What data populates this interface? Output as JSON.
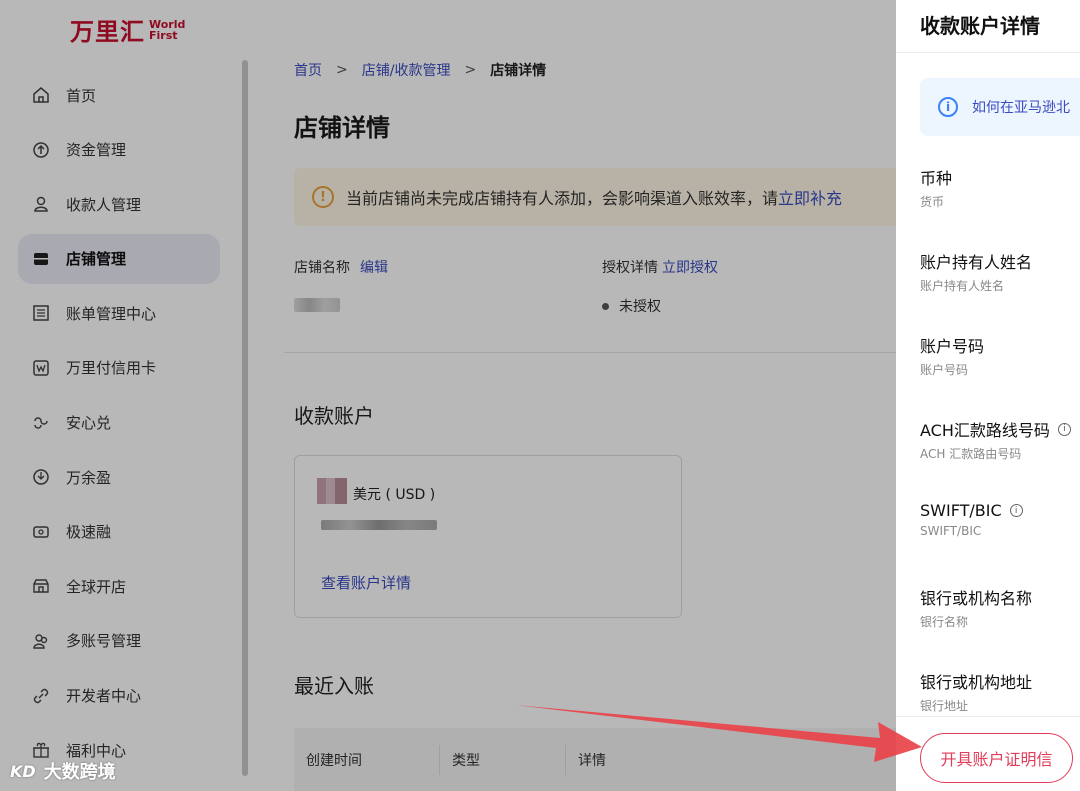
{
  "logo": {
    "cn": "万里汇",
    "en_line1": "World",
    "en_line2": "First"
  },
  "sidebar": {
    "items": [
      {
        "label": "首页",
        "icon": "home-icon"
      },
      {
        "label": "资金管理",
        "icon": "upload-circle-icon"
      },
      {
        "label": "收款人管理",
        "icon": "user-icon"
      },
      {
        "label": "店铺管理",
        "icon": "store-icon",
        "active": true
      },
      {
        "label": "账单管理中心",
        "icon": "list-icon"
      },
      {
        "label": "万里付信用卡",
        "icon": "card-w-icon"
      },
      {
        "label": "安心兑",
        "icon": "exchange-icon"
      },
      {
        "label": "万余盈",
        "icon": "shield-icon"
      },
      {
        "label": "极速融",
        "icon": "money-icon"
      },
      {
        "label": "全球开店",
        "icon": "shop-icon"
      },
      {
        "label": "多账号管理",
        "icon": "users-icon"
      },
      {
        "label": "开发者中心",
        "icon": "link-icon"
      },
      {
        "label": "福利中心",
        "icon": "gift-icon"
      }
    ]
  },
  "breadcrumb": {
    "home": "首页",
    "sep": ">",
    "parent": "店铺/收款管理",
    "current": "店铺详情"
  },
  "page": {
    "title": "店铺详情",
    "warning_text": "当前店铺尚未完成店铺持有人添加，会影响渠道入账效率，请",
    "warning_link": "立即补充",
    "store_name_label": "店铺名称",
    "store_name_edit": "编辑",
    "auth_label": "授权详情",
    "auth_link": "立即授权",
    "auth_status": "未授权",
    "accounts_title": "收款账户",
    "account_currency": "美元 ( USD )",
    "account_link": "查看账户详情",
    "recent_title": "最近入账",
    "table_headers": [
      "创建时间",
      "类型",
      "详情"
    ]
  },
  "drawer": {
    "title": "收款账户详情",
    "info_text": "如何在亚马逊北",
    "fields": [
      {
        "label": "币种",
        "sub": "货币"
      },
      {
        "label": "账户持有人姓名",
        "sub": "账户持有人姓名"
      },
      {
        "label": "账户号码",
        "sub": "账户号码"
      },
      {
        "label": "ACH汇款路线号码",
        "sub": "ACH 汇款路由号码"
      },
      {
        "label": "SWIFT/BIC",
        "sub": "SWIFT/BIC"
      },
      {
        "label": "银行或机构名称",
        "sub": "银行名称"
      },
      {
        "label": "银行或机构地址",
        "sub": "银行地址"
      }
    ],
    "cert_button": "开具账户证明信"
  },
  "watermark": {
    "logo": "KD",
    "text": "大数跨境"
  },
  "colors": {
    "brand": "#c8102e",
    "link": "#3b4cc0",
    "accent_red": "#e23c5a",
    "warning": "#e6a23c"
  }
}
